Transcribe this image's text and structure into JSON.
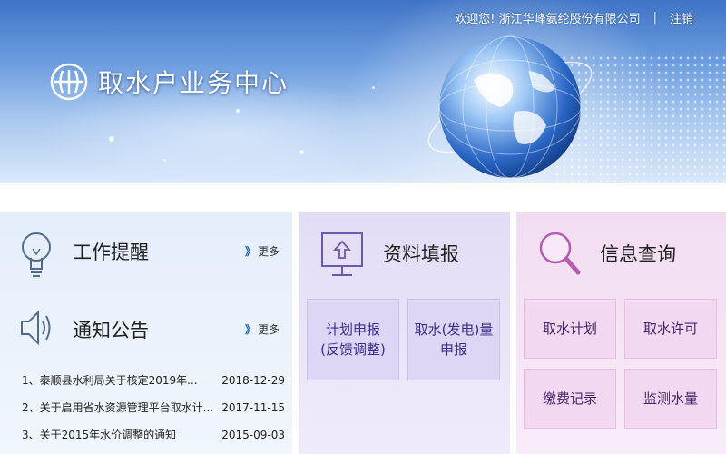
{
  "header": {
    "welcome_text": "欢迎您! 浙江华峰氨纶股份有限公司",
    "separator": "|",
    "logout_label": "注销",
    "app_title": "取水户业务中心"
  },
  "work_reminder": {
    "title": "工作提醒",
    "more_label": "更多"
  },
  "notices": {
    "title": "通知公告",
    "more_label": "更多",
    "items": [
      {
        "title": "1、泰顺县水利局关于核定2019年...",
        "date": "2018-12-29"
      },
      {
        "title": "2、关于启用省水资源管理平台取水计...",
        "date": "2017-11-15"
      },
      {
        "title": "3、关于2015年水价调整的通知",
        "date": "2015-09-03"
      }
    ]
  },
  "data_entry": {
    "title": "资料填报",
    "buttons": [
      {
        "line1": "计划申报",
        "line2": "(反馈调整)"
      },
      {
        "line1": "取水(发电)量",
        "line2": "申报"
      }
    ]
  },
  "info_query": {
    "title": "信息查询",
    "buttons": [
      "取水计划",
      "取水许可",
      "缴费记录",
      "监测水量"
    ]
  },
  "colors": {
    "left_panel": "#e4eefb",
    "mid_panel": "#e3dcf6",
    "right_panel": "#f2dcf1",
    "mid_button_text": "#3b2d8c",
    "right_button_text": "#4a2366"
  }
}
